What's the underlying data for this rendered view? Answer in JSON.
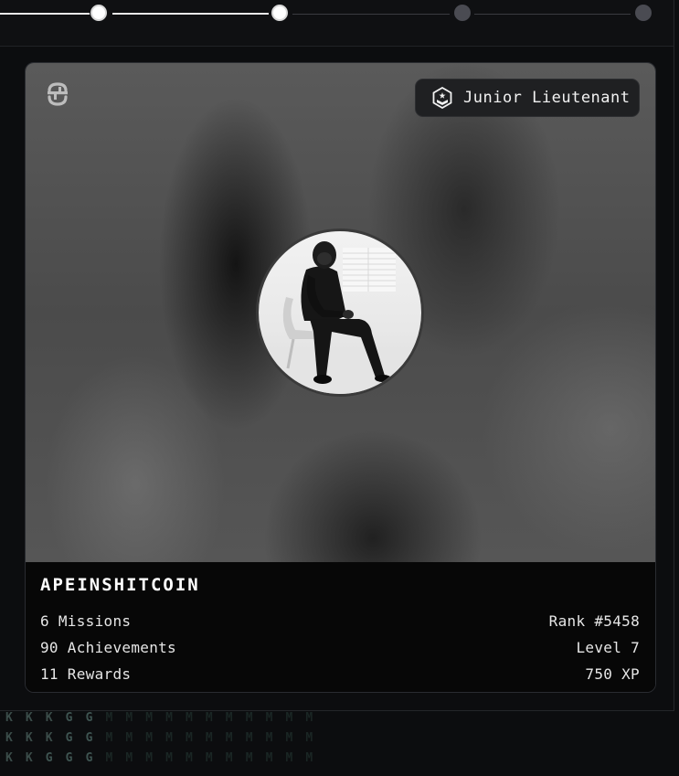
{
  "stepper": {
    "steps": [
      "done",
      "done",
      "todo",
      "todo"
    ]
  },
  "card": {
    "rank_badge": {
      "label": "Junior Lieutenant",
      "icon": "rank-insignia-icon"
    },
    "logo_icon": "brand-logo-icon",
    "avatar": "profile-avatar",
    "username": "APEINSHITCOIN",
    "stats_left": [
      "6 Missions",
      "90 Achievements",
      "11 Rewards"
    ],
    "stats_right": [
      "Rank #5458",
      "Level 7",
      "750 XP"
    ]
  },
  "ticker": {
    "rows": [
      [
        "K",
        "K",
        "K",
        "G",
        "G",
        "M",
        "M",
        "M",
        "M",
        "M",
        "M",
        "M",
        "M",
        "M",
        "M",
        "M"
      ],
      [
        "K",
        "K",
        "K",
        "G",
        "G",
        "M",
        "M",
        "M",
        "M",
        "M",
        "M",
        "M",
        "M",
        "M",
        "M",
        "M"
      ],
      [
        "K",
        "K",
        "G",
        "G",
        "G",
        "M",
        "M",
        "M",
        "M",
        "M",
        "M",
        "M",
        "M",
        "M",
        "M",
        "M"
      ]
    ]
  },
  "colors": {
    "background": "#0c0d0f",
    "card_info_bg": "#070707",
    "step_done": "#ffffff",
    "step_todo": "#4a4b52",
    "text_primary": "#ffffff"
  }
}
